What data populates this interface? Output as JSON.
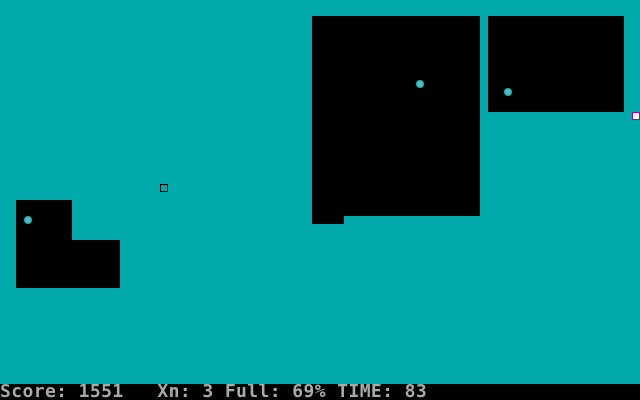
{
  "game": {
    "status": {
      "score_label": "Score:",
      "score_value": "1551",
      "lives_label": "Xn:",
      "lives_value": "3",
      "fill_label": "Full:",
      "fill_value": "69%",
      "time_label": "TIME:",
      "time_value": "83"
    },
    "colors": {
      "claimed_field": "#00AAAA",
      "void": "#000000",
      "status_bar": "#000000",
      "status_text": "#AAAAAA",
      "ball": "#55BBBB",
      "marker_border": "#AA00AA"
    },
    "entities": {
      "ball_count": 3,
      "player_marker": "player-cursor",
      "enemy": "sparx"
    }
  }
}
